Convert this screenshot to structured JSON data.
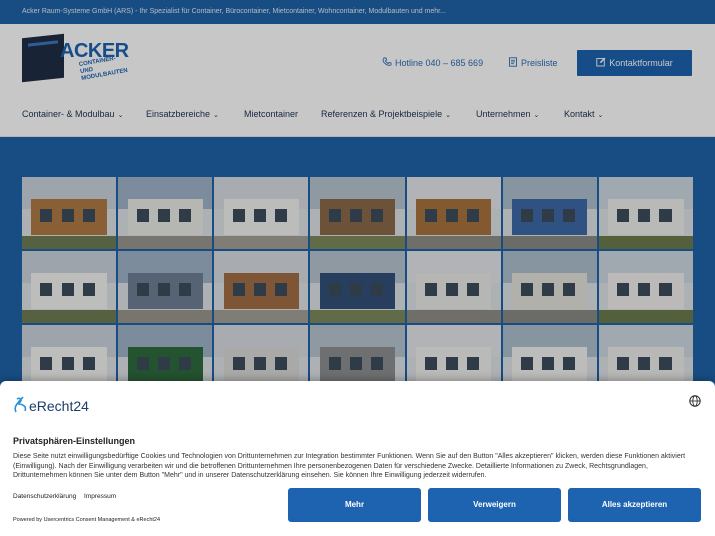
{
  "topbar": {
    "text": "Acker Raum-Systeme GmbH (ARS) - Ihr Spezialist für Container, Bürocontainer, Mietcontainer, Wohncontainer, Modulbauten und mehr..."
  },
  "logo": {
    "name": "ACKER",
    "sub1": "CONTAINER- UND",
    "sub2": "MODULBAUTEN"
  },
  "header": {
    "hotline": "Hotline 040 – 685 669",
    "pricelist": "Preisliste",
    "contact_button": "Kontaktformular"
  },
  "nav": {
    "items": [
      {
        "label": "Container- & Modulbau",
        "has_dropdown": true
      },
      {
        "label": "Einsatzbereiche",
        "has_dropdown": true
      },
      {
        "label": "Mietcontainer",
        "has_dropdown": false
      },
      {
        "label": "Referenzen & Projektbeispiele",
        "has_dropdown": true
      },
      {
        "label": "Unternehmen",
        "has_dropdown": true
      },
      {
        "label": "Kontakt",
        "has_dropdown": true
      }
    ]
  },
  "colors": {
    "brand": "#1d63b0",
    "hero": "#1f63a8",
    "nav_text": "#1c3350"
  },
  "consent": {
    "brand": "eRecht24",
    "title": "Privatsphären-Einstellungen",
    "text": "Diese Seite nutzt einwilligungsbedürftige Cookies und Technologien von Drittunternehmen zur Integration bestimmter Funktionen. Wenn Sie auf den Button \"Alles akzeptieren\" klicken, werden diese Funktionen aktiviert (Einwilligung). Nach der Einwilligung verarbeiten wir und die betroffenen Drittunternehmen Ihre personenbezogenen Daten für verschiedene Zwecke. Detaillierte Informationen zu Zweck, Rechtsgrundlagen, Drittunternehmen können Sie unter dem Button \"Mehr\" und in unserer Datenschutzerklärung einsehen. Sie können Ihre Einwilligung jederzeit widerrufen.",
    "link_privacy": "Datenschutzerklärung",
    "link_imprint": "Impressum",
    "powered": "Powered by Usercentrics Consent Management & eRecht24",
    "btn_more": "Mehr",
    "btn_deny": "Verweigern",
    "btn_accept": "Alles akzeptieren"
  }
}
